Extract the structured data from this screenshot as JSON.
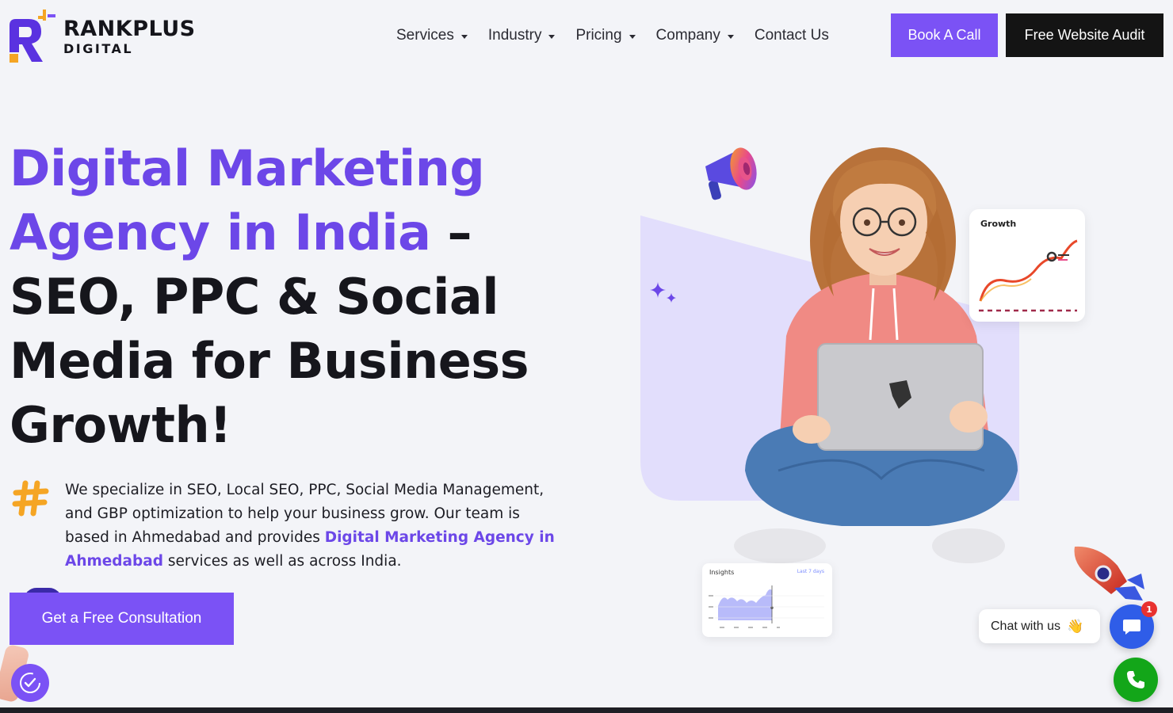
{
  "brand": {
    "name": "RANKPLUS",
    "sub": "DIGITAL",
    "colors": {
      "primary": "#7b52f5",
      "accent_text": "#6c47e8",
      "logo_orange": "#f5a524",
      "dark": "#141414"
    }
  },
  "nav": {
    "items": [
      {
        "label": "Services",
        "dropdown": true
      },
      {
        "label": "Industry",
        "dropdown": true
      },
      {
        "label": "Pricing",
        "dropdown": true
      },
      {
        "label": "Company",
        "dropdown": true
      },
      {
        "label": "Contact Us",
        "dropdown": false
      }
    ],
    "book_call": "Book A Call",
    "free_audit": "Free Website Audit"
  },
  "hero": {
    "title_accent": "Digital Marketing Agency in India",
    "title_rest_1": " –",
    "title_rest_2": "SEO, PPC & Social Media for Business Growth!",
    "desc_before": "We specialize in SEO, Local SEO, PPC, Social Media Management, and GBP optimization to help your business grow. Our team is based in Ahmedabad and provides ",
    "desc_link": "Digital Marketing Agency in Ahmedabad",
    "desc_after": " services as well as across India.",
    "cta": "Get a Free Consultation"
  },
  "illustration": {
    "growth_label": "Growth",
    "insights_title": "Insights",
    "insights_range": "Last 7 days"
  },
  "widgets": {
    "chat_label": "Chat with us",
    "chat_emoji": "👋",
    "chat_badge": "1"
  },
  "icons": [
    "logo-mark-icon",
    "hashtag-icon",
    "megaphone-icon",
    "sparkle-icon",
    "rocket-icon",
    "chat-bubble-icon",
    "phone-icon",
    "accessibility-icon"
  ]
}
